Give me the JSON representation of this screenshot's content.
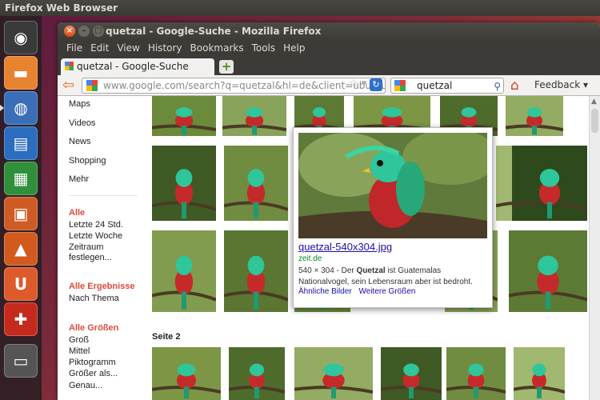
{
  "os_topbar": {
    "title": "Firefox Web Browser"
  },
  "launcher": {
    "items": [
      {
        "name": "Ubuntu Dash",
        "glyph": "◉",
        "color": "#3a3a3a"
      },
      {
        "name": "Files",
        "glyph": "▬",
        "color": "#e8832f"
      },
      {
        "name": "Firefox",
        "glyph": "◍",
        "color": "#3a6fb8"
      },
      {
        "name": "Writer",
        "glyph": "▤",
        "color": "#2d6dbf"
      },
      {
        "name": "Calc",
        "glyph": "▦",
        "color": "#2f8f3a"
      },
      {
        "name": "Impress",
        "glyph": "▣",
        "color": "#cf5b24"
      },
      {
        "name": "Software Center",
        "glyph": "▲",
        "color": "#d25a1e"
      },
      {
        "name": "Ubuntu One",
        "glyph": "U",
        "color": "#dd5a2b"
      },
      {
        "name": "System Settings",
        "glyph": "✚",
        "color": "#c42b1c"
      },
      {
        "name": "Workspaces",
        "glyph": "▭",
        "color": "#555"
      }
    ]
  },
  "window": {
    "title": "quetzal - Google-Suche - Mozilla Firefox"
  },
  "menubar": {
    "items": [
      "File",
      "Edit",
      "View",
      "History",
      "Bookmarks",
      "Tools",
      "Help"
    ]
  },
  "tab": {
    "label": "quetzal - Google-Suche",
    "new_tab": "+"
  },
  "navbar": {
    "url": "www.google.com/search?q=quetzal&hl=de&client=ubuntu",
    "search_value": "quetzal",
    "feedback": "Feedback"
  },
  "leftnav": {
    "items": [
      "Maps",
      "Videos",
      "News",
      "Shopping",
      "Mehr"
    ],
    "time_header": "Alle",
    "time_items": [
      "Letzte 24 Std.",
      "Letzte Woche",
      "Zeitraum",
      "festlegen..."
    ],
    "results_header": "Alle Ergebnisse",
    "results_items": [
      "Nach Thema"
    ],
    "size_header": "Alle Größen",
    "size_items": [
      "Groß",
      "Mittel",
      "Piktogramm",
      "Größer als...",
      "Genau..."
    ]
  },
  "results": {
    "page2_label": "Seite 2"
  },
  "popup": {
    "title": "quetzal-540x304.jpg",
    "domain": "zeit.de",
    "desc_prefix": "540 × 304 - Der ",
    "desc_bold": "Quetzal",
    "desc_suffix": " ist Guatemalas Nationalvogel, sein Lebensraum aber ist bedroht.",
    "link_similar": "Ähnliche Bilder",
    "link_larger": "Weitere Größen"
  },
  "colors": {
    "google_red": "#dd4b39",
    "link_blue": "#1a0dab",
    "domain_green": "#0a8a23"
  }
}
